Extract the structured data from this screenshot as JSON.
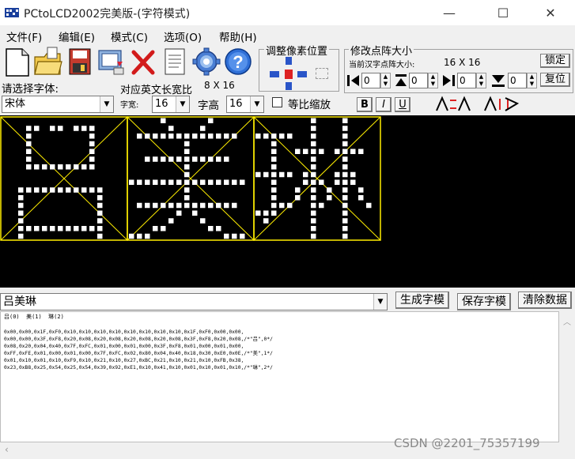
{
  "window": {
    "title": "PCtoLCD2002完美版-(字符模式)",
    "min_glyph": "—",
    "max_glyph": "☐",
    "close_glyph": "✕"
  },
  "menu": [
    "文件(F)",
    "编辑(E)",
    "模式(C)",
    "选项(O)",
    "帮助(H)"
  ],
  "toolbar": {
    "icons": [
      "new-file-icon",
      "open-folder-icon",
      "save-disk-icon",
      "import-image-icon",
      "delete-x-icon",
      "notes-icon",
      "settings-gear-icon",
      "help-icon"
    ],
    "help_glyph": "?"
  },
  "adjust_panel": {
    "title": "调整像素位置"
  },
  "dot_size_panel": {
    "title": "修改点阵大小",
    "current_label": "当前汉字点阵大小:",
    "current_value": "16 X 16",
    "lock_button": "锁定",
    "reset_button": "复位",
    "spinners": [
      "0",
      "0",
      "0",
      "0"
    ]
  },
  "font": {
    "prompt": "请选择字体:",
    "ratio_label": "对应英文长宽比",
    "ratio_value": "8 X 16",
    "family": "宋体",
    "width_label": "字宽:",
    "width_value": "16",
    "height_label": "字高",
    "height_value": "16",
    "scale_label": "等比缩放",
    "bold": "B",
    "italic": "I",
    "underline": "U"
  },
  "bottom": {
    "input_text": "吕美琳",
    "generate_button": "生成字模",
    "save_button": "保存字模",
    "clear_button": "清除数据",
    "output_header": "吕(0)  美(1)  琳(2)",
    "output_lines": [
      "0x00,0x00,0x1F,0xF0,0x10,0x10,0x10,0x10,0x10,0x10,0x10,0x10,0x1F,0xF0,0x00,0x00,",
      "0x00,0x00,0x3F,0xF8,0x20,0x08,0x20,0x08,0x20,0x08,0x20,0x08,0x3F,0xF8,0x20,0x08,/*\"吕\",0*/",
      "0x08,0x20,0x04,0x40,0x7F,0xFC,0x01,0x00,0x01,0x00,0x3F,0xF8,0x01,0x00,0x01,0x00,",
      "0xFF,0xFE,0x01,0x00,0x01,0x00,0x7F,0xFC,0x02,0x80,0x04,0x40,0x18,0x30,0xE0,0x0E,/*\"美\",1*/",
      "0x01,0x10,0x01,0x10,0xF9,0x10,0x21,0x10,0x27,0xBC,0x21,0x10,0x21,0x10,0xFB,0x38,",
      "0x23,0xB8,0x25,0x54,0x25,0x54,0x39,0x92,0xE1,0x10,0x41,0x10,0x01,0x10,0x01,0x10,/*\"琳\",2*/"
    ]
  },
  "watermark": "CSDN @2201_75357199",
  "glyph_rows": [
    [
      0,
      7024,
      4112,
      4112,
      4112,
      4112,
      8176,
      0,
      0,
      16376,
      8200,
      8200,
      8200,
      8200,
      16376,
      8200
    ],
    [
      2080,
      1088,
      32764,
      256,
      256,
      16376,
      256,
      256,
      65534,
      256,
      256,
      32764,
      640,
      1088,
      6192,
      57358
    ],
    [
      272,
      272,
      63760,
      8464,
      10172,
      8464,
      8464,
      64312,
      9144,
      9556,
      9556,
      14738,
      57616,
      16656,
      272,
      272
    ]
  ],
  "colors": {
    "grid": "#ffee00",
    "dot": "#ffffff",
    "canvas": "#000000"
  }
}
